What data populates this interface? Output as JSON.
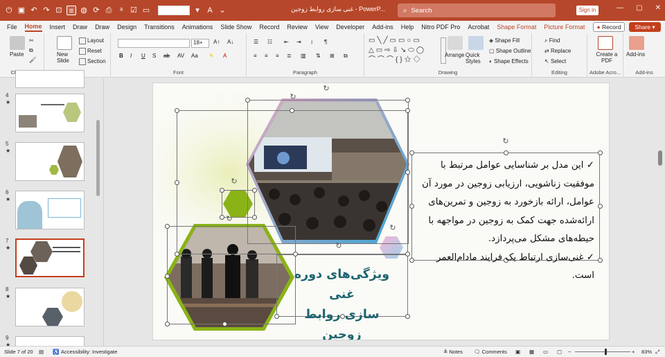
{
  "titlebar": {
    "title": "غنی سازی روابط زوجین  -  PowerP...",
    "search_placeholder": "Search",
    "signin_label": "Sign in",
    "quick_access": [
      "autosave-icon",
      "save-icon",
      "undo-icon",
      "redo-icon",
      "presentation-icon",
      "slide-layout-icon",
      "shape-icon",
      "refresh-icon",
      "print-icon",
      "spellcheck-icon",
      "checkbox-icon",
      "format-icon"
    ],
    "accent_color": "#b7472a"
  },
  "menu": {
    "tabs": [
      "File",
      "Home",
      "Insert",
      "Draw",
      "Draw",
      "Design",
      "Transitions",
      "Animations",
      "Slide Show",
      "Record",
      "Review",
      "View",
      "Developer",
      "Add-ins",
      "Help",
      "Nitro PDF Pro",
      "Acrobat",
      "Shape Format",
      "Picture Format"
    ],
    "active_tab": "Home",
    "record_label": "Record",
    "share_label": "Share"
  },
  "ribbon": {
    "clipboard": {
      "label": "Clipboard",
      "paste": "Paste"
    },
    "slides": {
      "label": "Slides",
      "new_slide": "New Slide",
      "layout": "Layout",
      "reset": "Reset",
      "section": "Section"
    },
    "font": {
      "label": "Font",
      "size": "18+"
    },
    "paragraph": {
      "label": "Paragraph"
    },
    "drawing": {
      "label": "Drawing",
      "arrange": "Arrange",
      "quick_styles": "Quick Styles",
      "shape_fill": "Shape Fill",
      "shape_outline": "Shape Outline",
      "shape_effects": "Shape Effects"
    },
    "editing": {
      "label": "Editing",
      "find": "Find",
      "replace": "Replace",
      "select": "Select"
    },
    "adobe": {
      "label": "Adobe Acro...",
      "create_pdf": "Create a PDF"
    },
    "addins": {
      "label": "Add-ins",
      "button": "Add-ins"
    }
  },
  "thumbnails": [
    {
      "num": "4",
      "star": "★"
    },
    {
      "num": "5",
      "star": "★"
    },
    {
      "num": "6",
      "star": "★"
    },
    {
      "num": "7",
      "star": "★"
    },
    {
      "num": "8",
      "star": "★"
    },
    {
      "num": "9",
      "star": "★"
    }
  ],
  "slide": {
    "bullets": [
      "این مدل بر شناسایی عوامل مرتبط با موفقیت زناشویی، ارزیابی زوجین در مورد آن عوامل، ارائه بازخورد به زوجین و تمرین‌های ارائه‌شده جهت کمک به زوجین در مواجهه با حیطه‌های مشکل می‌پردازد.",
      "غنی‌سازی ارتباط یک فرایند مادام‌العمر است."
    ],
    "bullet_mark": "✓",
    "headline_line1": "ویژگی‌های دوره غنی",
    "headline_line2": "سازی روابط زوجین",
    "headline_color": "#1e6470",
    "hex_green": "#8ab317",
    "hex_blue": "#3fa9d6",
    "hex_pink": "#e8a8c6"
  },
  "status": {
    "slide_info": "Slide 7 of 20",
    "accessibility": "Accessibility: Investigate",
    "notes": "Notes",
    "comments": "Comments",
    "zoom": "83%"
  }
}
